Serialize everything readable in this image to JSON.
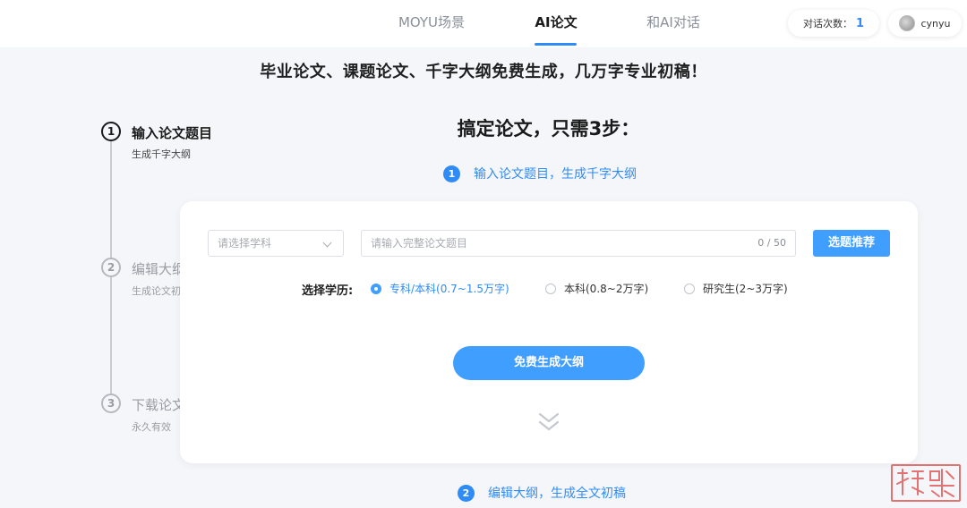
{
  "nav": {
    "tabs": [
      {
        "label": "MOYU场景"
      },
      {
        "label": "AI论文"
      },
      {
        "label": "和AI对话"
      }
    ],
    "active_tab": 1,
    "chat_count_label": "对话次数：",
    "chat_count": "1",
    "username": "cynyu"
  },
  "headline": "毕业论文、课题论文、千字大纲免费生成，几万字专业初稿！",
  "sidebar": {
    "steps": [
      {
        "num": "1",
        "title": "输入论文题目",
        "sub": "生成千字大纲"
      },
      {
        "num": "2",
        "title": "编辑大纲",
        "sub": "生成论文初稿"
      },
      {
        "num": "3",
        "title": "下载论文",
        "sub": "永久有效"
      }
    ]
  },
  "main": {
    "heading": "搞定论文，只需3步：",
    "flow": [
      {
        "num": "1",
        "label": "输入论文题目，生成千字大纲"
      },
      {
        "num": "2",
        "label": "编辑大纲，生成全文初稿"
      }
    ]
  },
  "form": {
    "subject_placeholder": "请选择学科",
    "topic_placeholder": "请输入完整论文题目",
    "counter": "0 / 50",
    "recommend_label": "选题推荐",
    "education_label": "选择学历:",
    "education_options": [
      {
        "label": "专科/本科(0.7~1.5万字)",
        "checked": true
      },
      {
        "label": "本科(0.8~2万字)",
        "checked": false
      },
      {
        "label": "研究生(2~3万字)",
        "checked": false
      }
    ],
    "generate_label": "免费生成大纲"
  },
  "colors": {
    "accent": "#409eff",
    "accent_text": "#2f8cf7",
    "watermark": "#e37373"
  }
}
